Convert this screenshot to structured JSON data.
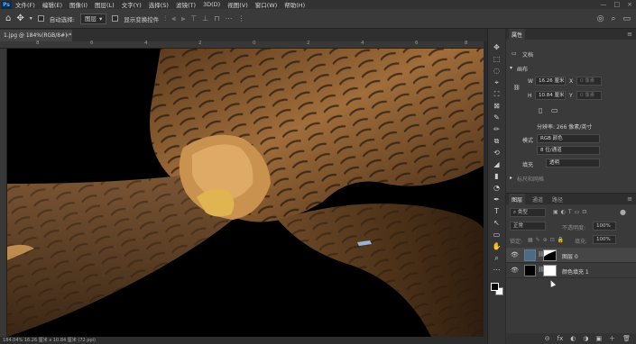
{
  "menubar": {
    "logo": "Ps",
    "items": [
      "文件(F)",
      "编辑(E)",
      "图像(I)",
      "图层(L)",
      "文字(Y)",
      "选择(S)",
      "滤镜(T)",
      "3D(D)",
      "视图(V)",
      "窗口(W)",
      "帮助(H)"
    ],
    "window_controls": [
      "—",
      "□",
      "×"
    ]
  },
  "options": {
    "home_icon": "home-icon",
    "move_icon": "move-icon",
    "auto_select_label": "自动选择:",
    "auto_select_value": "图层",
    "show_transform_label": "显示变换控件",
    "align_icons": [
      "⫶",
      "⫷",
      "⫸",
      "⊤",
      "⊥",
      "⊓",
      "⋯",
      "⋮"
    ]
  },
  "document": {
    "tab_title": "1.jpg @ 184%(RGB/8#) *",
    "ruler_marks": [
      "8",
      "6",
      "4",
      "2",
      "0",
      "2",
      "4",
      "6",
      "8"
    ],
    "status": "184.04%  16.26 厘米 x 10.84 厘米 (72 ppi)"
  },
  "tools": [
    "✥",
    "⬚",
    "◌",
    "⌖",
    "⛶",
    "⊠",
    "✎",
    "✏",
    "⧉",
    "⟲",
    "◢",
    "▮",
    "◔",
    "✒",
    "T",
    "↖",
    "▭",
    "✋",
    "⌕",
    "⋯"
  ],
  "properties": {
    "tabs": [
      "属性"
    ],
    "doc_label": "文档",
    "canvas_section": "画布",
    "w_label": "W",
    "w_value": "16.26 厘米",
    "x_label": "X",
    "x_value": "0 像素",
    "h_label": "H",
    "h_value": "10.84 厘米",
    "y_label": "Y",
    "y_value": "0 像素",
    "resolution": "分辨率: 266 像素/英寸",
    "mode_label": "模式",
    "mode_value": "RGB 颜色",
    "depth_value": "8 位/通道",
    "fill_label": "填充",
    "fill_value": "透明",
    "more_label": "标尺和网格"
  },
  "layers": {
    "tabs": [
      "图层",
      "通道",
      "路径"
    ],
    "filter_value": "类型",
    "blend_value": "正常",
    "opacity_label": "不透明度:",
    "opacity_value": "100%",
    "lock_label": "锁定:",
    "fill_label": "填充:",
    "fill_value": "100%",
    "items": [
      {
        "name": "图层 0",
        "selected": true
      },
      {
        "name": "颜色填充 1",
        "selected": false
      }
    ],
    "footer_icons": [
      "⊝",
      "fx",
      "◐",
      "◑",
      "▣",
      "＋",
      "🗑"
    ]
  }
}
